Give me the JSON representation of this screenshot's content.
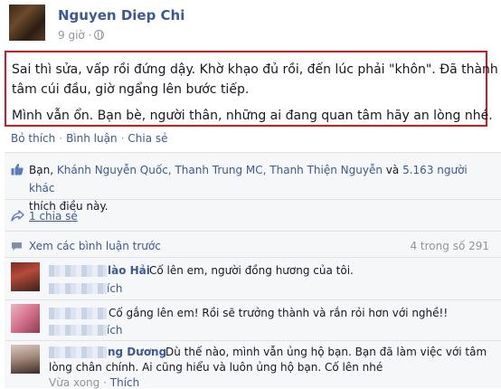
{
  "post": {
    "author": "Nguyen Diep Chi",
    "time": "9 giờ ·",
    "paragraph1_line1": "Sai thì sửa, vấp rồi đứng dậy. Khờ khạo đủ rồi, đến lúc phải \"khôn\". Đã thành",
    "paragraph1_line2": "tâm cúi đầu, giờ ngẩng lên bước tiếp.",
    "paragraph2": "Mình vẫn ổn. Bạn bè, người thân, những ai đang quan tâm hãy an lòng nhé."
  },
  "actions": {
    "unlike": "Bỏ thích",
    "comment": "Bình luận",
    "share": "Chia sẻ",
    "separator": "·"
  },
  "likes": {
    "prefix": "Bạn,",
    "name1": "Khánh Nguyễn Quốc,",
    "name2": "Thanh Trung MC,",
    "name3": "Thanh Thiện Nguyễn",
    "and": "và",
    "others": "5.163 người khác",
    "suffix": "thích điều này."
  },
  "shares": {
    "label": "1 chia sẻ"
  },
  "comments": {
    "view_previous": "Xem các bình luận trước",
    "count": "4 trong số 291",
    "items": [
      {
        "name": "lào Hải",
        "text": "Cố lên em, người đồng hương của tôi.",
        "meta": "ích"
      },
      {
        "name": "",
        "text": "Cố gắng lên em! Rồi sẽ trưởng thành và rắn rỏi hơn với nghề!!",
        "meta": "ích"
      },
      {
        "name": "ng Dương",
        "text_line1": "Dù thế nào, mình vẫn ủng hộ bạn. Bạn đã làm việc với tâm",
        "text_line2": "lòng chân chính. Ai cũng hiểu và luôn ủng hộ bạn. Cố lên nhé",
        "meta_time": "Vừa xong",
        "meta_sep": "·",
        "meta_like": "Thích"
      }
    ]
  },
  "colors": {
    "link": "#3b5998",
    "highlight_border": "#d9161e",
    "muted": "#90949c",
    "panel": "#f6f7f9"
  }
}
